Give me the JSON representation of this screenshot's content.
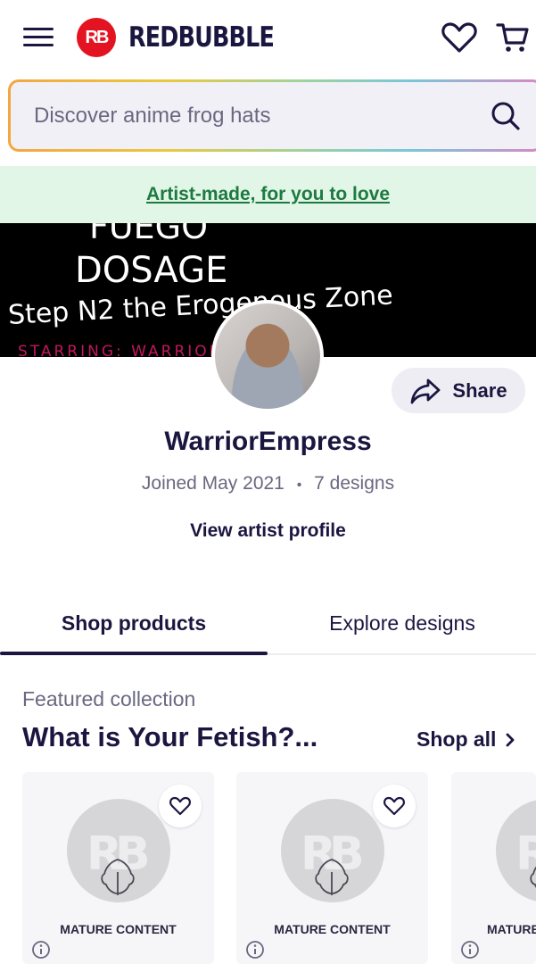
{
  "header": {
    "brand": "REDBUBBLE",
    "logo_mark": "RB",
    "icons": [
      "menu-icon",
      "heart-icon",
      "cart-icon"
    ]
  },
  "search": {
    "placeholder": "Discover anime frog hats",
    "icon": "search-icon"
  },
  "promo": {
    "text": "Artist-made, for you to love",
    "bg_color": "#e2f6e7",
    "text_color": "#1d7a41"
  },
  "cover": {
    "line1": "FUEGO",
    "line2": "DOSAGE",
    "line3": "Step N2 the Erogenous Zone",
    "line4": "STARRING: WARRIOR EMPRESS"
  },
  "artist": {
    "name": "WarriorEmpress",
    "joined": "Joined May 2021",
    "separator": "•",
    "designs": "7 designs",
    "profile_link": "View artist profile"
  },
  "share": {
    "label": "Share"
  },
  "tabs": [
    {
      "label": "Shop products",
      "active": true
    },
    {
      "label": "Explore designs",
      "active": false
    }
  ],
  "featured": {
    "label": "Featured collection",
    "title": "What is Your Fetish?...",
    "shop_all": "Shop all"
  },
  "cards": [
    {
      "badge": "MATURE CONTENT"
    },
    {
      "badge": "MATURE CONTENT"
    },
    {
      "badge": "MATURE CONTENT"
    }
  ],
  "colors": {
    "brand_red": "#e41321",
    "ink": "#1b1640",
    "muted": "#6a6880"
  }
}
